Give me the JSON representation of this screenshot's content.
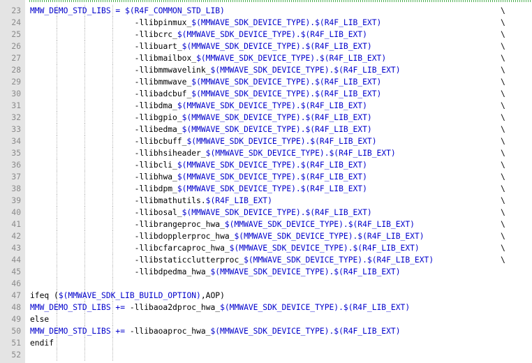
{
  "editor": {
    "colors": {
      "blue": "#0000cc",
      "black": "#000000",
      "gutter": "#e4e4e4",
      "line_number": "#8a8a8a"
    },
    "lines": [
      {
        "num": "23",
        "bs": true,
        "tokens": [
          {
            "t": "MMW_DEMO_STD_LIBS = $(R4F_COMMON_STD_LIB)",
            "c": "blue"
          }
        ]
      },
      {
        "num": "24",
        "bs": true,
        "tokens": [
          {
            "t": "                      ",
            "c": "black"
          },
          {
            "t": "-llibpinmux_",
            "c": "black"
          },
          {
            "t": "$(MMWAVE_SDK_DEVICE_TYPE).$(R4F_LIB_EXT)",
            "c": "blue"
          }
        ]
      },
      {
        "num": "25",
        "bs": true,
        "tokens": [
          {
            "t": "                      ",
            "c": "black"
          },
          {
            "t": "-llibcrc_",
            "c": "black"
          },
          {
            "t": "$(MMWAVE_SDK_DEVICE_TYPE).$(R4F_LIB_EXT)",
            "c": "blue"
          }
        ]
      },
      {
        "num": "26",
        "bs": true,
        "tokens": [
          {
            "t": "                      ",
            "c": "black"
          },
          {
            "t": "-llibuart_",
            "c": "black"
          },
          {
            "t": "$(MMWAVE_SDK_DEVICE_TYPE).$(R4F_LIB_EXT)",
            "c": "blue"
          }
        ]
      },
      {
        "num": "27",
        "bs": true,
        "tokens": [
          {
            "t": "                      ",
            "c": "black"
          },
          {
            "t": "-llibmailbox_",
            "c": "black"
          },
          {
            "t": "$(MMWAVE_SDK_DEVICE_TYPE).$(R4F_LIB_EXT)",
            "c": "blue"
          }
        ]
      },
      {
        "num": "28",
        "bs": true,
        "tokens": [
          {
            "t": "                      ",
            "c": "black"
          },
          {
            "t": "-llibmmwavelink_",
            "c": "black"
          },
          {
            "t": "$(MMWAVE_SDK_DEVICE_TYPE).$(R4F_LIB_EXT)",
            "c": "blue"
          }
        ]
      },
      {
        "num": "29",
        "bs": true,
        "tokens": [
          {
            "t": "                      ",
            "c": "black"
          },
          {
            "t": "-llibmmwave_",
            "c": "black"
          },
          {
            "t": "$(MMWAVE_SDK_DEVICE_TYPE).$(R4F_LIB_EXT)",
            "c": "blue"
          }
        ]
      },
      {
        "num": "30",
        "bs": true,
        "tokens": [
          {
            "t": "                      ",
            "c": "black"
          },
          {
            "t": "-llibadcbuf_",
            "c": "black"
          },
          {
            "t": "$(MMWAVE_SDK_DEVICE_TYPE).$(R4F_LIB_EXT)",
            "c": "blue"
          }
        ]
      },
      {
        "num": "31",
        "bs": true,
        "tokens": [
          {
            "t": "                      ",
            "c": "black"
          },
          {
            "t": "-llibdma_",
            "c": "black"
          },
          {
            "t": "$(MMWAVE_SDK_DEVICE_TYPE).$(R4F_LIB_EXT)",
            "c": "blue"
          }
        ]
      },
      {
        "num": "32",
        "bs": true,
        "tokens": [
          {
            "t": "                      ",
            "c": "black"
          },
          {
            "t": "-llibgpio_",
            "c": "black"
          },
          {
            "t": "$(MMWAVE_SDK_DEVICE_TYPE).$(R4F_LIB_EXT)",
            "c": "blue"
          }
        ]
      },
      {
        "num": "33",
        "bs": true,
        "tokens": [
          {
            "t": "                      ",
            "c": "black"
          },
          {
            "t": "-llibedma_",
            "c": "black"
          },
          {
            "t": "$(MMWAVE_SDK_DEVICE_TYPE).$(R4F_LIB_EXT)",
            "c": "blue"
          }
        ]
      },
      {
        "num": "34",
        "bs": true,
        "tokens": [
          {
            "t": "                      ",
            "c": "black"
          },
          {
            "t": "-llibcbuff_",
            "c": "black"
          },
          {
            "t": "$(MMWAVE_SDK_DEVICE_TYPE).$(R4F_LIB_EXT)",
            "c": "blue"
          }
        ]
      },
      {
        "num": "35",
        "bs": true,
        "tokens": [
          {
            "t": "                      ",
            "c": "black"
          },
          {
            "t": "-llibhsiheader_",
            "c": "black"
          },
          {
            "t": "$(MMWAVE_SDK_DEVICE_TYPE).$(R4F_LIB_EXT)",
            "c": "blue"
          }
        ]
      },
      {
        "num": "36",
        "bs": true,
        "tokens": [
          {
            "t": "                      ",
            "c": "black"
          },
          {
            "t": "-llibcli_",
            "c": "black"
          },
          {
            "t": "$(MMWAVE_SDK_DEVICE_TYPE).$(R4F_LIB_EXT)",
            "c": "blue"
          }
        ]
      },
      {
        "num": "37",
        "bs": true,
        "tokens": [
          {
            "t": "                      ",
            "c": "black"
          },
          {
            "t": "-llibhwa_",
            "c": "black"
          },
          {
            "t": "$(MMWAVE_SDK_DEVICE_TYPE).$(R4F_LIB_EXT)",
            "c": "blue"
          }
        ]
      },
      {
        "num": "38",
        "bs": true,
        "tokens": [
          {
            "t": "                      ",
            "c": "black"
          },
          {
            "t": "-llibdpm_",
            "c": "black"
          },
          {
            "t": "$(MMWAVE_SDK_DEVICE_TYPE).$(R4F_LIB_EXT)",
            "c": "blue"
          }
        ]
      },
      {
        "num": "39",
        "bs": true,
        "tokens": [
          {
            "t": "                      ",
            "c": "black"
          },
          {
            "t": "-llibmathutils.",
            "c": "black"
          },
          {
            "t": "$(R4F_LIB_EXT)",
            "c": "blue"
          }
        ]
      },
      {
        "num": "40",
        "bs": true,
        "tokens": [
          {
            "t": "                      ",
            "c": "black"
          },
          {
            "t": "-llibosal_",
            "c": "black"
          },
          {
            "t": "$(MMWAVE_SDK_DEVICE_TYPE).$(R4F_LIB_EXT)",
            "c": "blue"
          }
        ]
      },
      {
        "num": "41",
        "bs": true,
        "tokens": [
          {
            "t": "                      ",
            "c": "black"
          },
          {
            "t": "-llibrangeproc_hwa_",
            "c": "black"
          },
          {
            "t": "$(MMWAVE_SDK_DEVICE_TYPE).$(R4F_LIB_EXT)",
            "c": "blue"
          }
        ]
      },
      {
        "num": "42",
        "bs": true,
        "tokens": [
          {
            "t": "                      ",
            "c": "black"
          },
          {
            "t": "-llibdopplerproc_hwa_",
            "c": "black"
          },
          {
            "t": "$(MMWAVE_SDK_DEVICE_TYPE).$(R4F_LIB_EXT)",
            "c": "blue"
          }
        ]
      },
      {
        "num": "43",
        "bs": true,
        "tokens": [
          {
            "t": "                      ",
            "c": "black"
          },
          {
            "t": "-llibcfarcaproc_hwa_",
            "c": "black"
          },
          {
            "t": "$(MMWAVE_SDK_DEVICE_TYPE).$(R4F_LIB_EXT)",
            "c": "blue"
          }
        ]
      },
      {
        "num": "44",
        "bs": true,
        "tokens": [
          {
            "t": "                      ",
            "c": "black"
          },
          {
            "t": "-llibstaticclutterproc_",
            "c": "black"
          },
          {
            "t": "$(MMWAVE_SDK_DEVICE_TYPE).$(R4F_LIB_EXT)",
            "c": "blue"
          }
        ]
      },
      {
        "num": "45",
        "bs": false,
        "tokens": [
          {
            "t": "                      ",
            "c": "black"
          },
          {
            "t": "-llibdpedma_hwa_",
            "c": "black"
          },
          {
            "t": "$(MMWAVE_SDK_DEVICE_TYPE).$(R4F_LIB_EXT)",
            "c": "blue"
          }
        ]
      },
      {
        "num": "46",
        "bs": false,
        "tokens": []
      },
      {
        "num": "47",
        "bs": false,
        "tokens": [
          {
            "t": "ifeq (",
            "c": "black"
          },
          {
            "t": "$(MMWAVE_SDK_LIB_BUILD_OPTION)",
            "c": "blue"
          },
          {
            "t": ",AOP)",
            "c": "black"
          }
        ]
      },
      {
        "num": "48",
        "bs": false,
        "tokens": [
          {
            "t": "MMW_DEMO_STD_LIBS += ",
            "c": "blue"
          },
          {
            "t": "-llibaoa2dproc_hwa_",
            "c": "black"
          },
          {
            "t": "$(MMWAVE_SDK_DEVICE_TYPE).$(R4F_LIB_EXT)",
            "c": "blue"
          }
        ]
      },
      {
        "num": "49",
        "bs": false,
        "tokens": [
          {
            "t": "else",
            "c": "black"
          }
        ]
      },
      {
        "num": "50",
        "bs": false,
        "tokens": [
          {
            "t": "MMW_DEMO_STD_LIBS += ",
            "c": "blue"
          },
          {
            "t": "-llibaoaproc_hwa_",
            "c": "black"
          },
          {
            "t": "$(MMWAVE_SDK_DEVICE_TYPE).$(R4F_LIB_EXT)",
            "c": "blue"
          }
        ]
      },
      {
        "num": "51",
        "bs": false,
        "tokens": [
          {
            "t": "endif",
            "c": "black"
          }
        ]
      },
      {
        "num": "52",
        "bs": false,
        "tokens": []
      }
    ],
    "backslash": "\\"
  }
}
